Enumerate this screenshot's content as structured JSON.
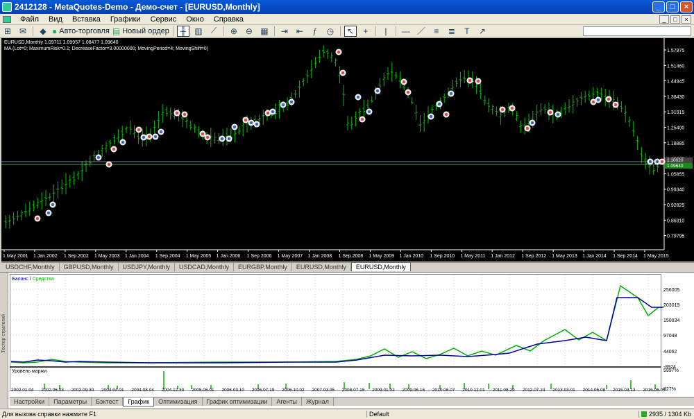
{
  "window": {
    "title": "2412128 - MetaQuotes-Demo - Демо-счет - [EURUSD,Monthly]",
    "controls": [
      "_",
      "□",
      "×"
    ]
  },
  "menu": {
    "items": [
      "Файл",
      "Вид",
      "Вставка",
      "Графики",
      "Сервис",
      "Окно",
      "Справка"
    ],
    "mdi_controls": [
      "_",
      "□",
      "×"
    ]
  },
  "toolbar": {
    "autotrade_label": "Авто-торговля",
    "neworder_label": "Новый ордер"
  },
  "chart": {
    "info_line1": "EURUSD,Monthly  1.09711 1.09957 1.08477 1.09640",
    "info_line2": "MA (Lot=0; MaximumRisk=0.1; DecreaseFactor=3.00000000; MovingPeriod=4; MovingShift=0)",
    "price_labels": [
      "1.57975",
      "1.51460",
      "1.44945",
      "1.38430",
      "1.31915",
      "1.25400",
      "1.18885",
      "1.12370",
      "1.05855",
      "0.99340",
      "0.92825",
      "0.86310",
      "0.79795"
    ],
    "current_price_1": "1.10020",
    "current_price_2": "1.09640",
    "time_labels": [
      "1 May 2001",
      "1 Jan 2002",
      "1 Sep 2002",
      "1 May 2003",
      "1 Jan 2004",
      "1 Sep 2004",
      "1 May 2005",
      "1 Jan 2006",
      "1 Sep 2006",
      "1 May 2007",
      "1 Jan 2008",
      "1 Sep 2008",
      "1 May 2009",
      "1 Jan 2010",
      "1 Sep 2010",
      "1 May 2011",
      "1 Jan 2012",
      "1 Sep 2012",
      "1 May 2013",
      "1 Jan 2014",
      "1 Sep 2014",
      "1 May 2015"
    ],
    "colors": {
      "bull": "#00c000",
      "bear": "#00c000",
      "buy_marker": "#3060c0",
      "sell_marker": "#e04040"
    }
  },
  "chart_tabs": [
    "USDCHF,Monthly",
    "GBPUSD,Monthly",
    "USDJPY,Monthly",
    "USDCAD,Monthly",
    "EURGBP,Monthly",
    "EURUSD,Monthly",
    "EURUSD,Monthly"
  ],
  "tester": {
    "side_label": "Тестер стратегий",
    "legend_balance": "Баланс",
    "legend_sep": " / ",
    "legend_equity": "Средства",
    "balance_color": "#0000a0",
    "equity_color": "#00b000",
    "y_labels": [
      "256005",
      "203019",
      "150034",
      "97048",
      "44062",
      "-8924"
    ],
    "margin_title": "Уровень маржи",
    "margin_labels": [
      "5997%",
      "827%"
    ],
    "date_labels": [
      "2002.01.04",
      "2002.06.03",
      "2003.09.30",
      "2004.04.01",
      "2004.08.04",
      "2004.12.30",
      "2005.06.01",
      "2006.03.10",
      "2006.07.19",
      "2006.10.02",
      "2007.03.05",
      "2008.07.15",
      "2009.01.02",
      "2009.06.16",
      "2010.06.07",
      "2010.12.01",
      "2011.08.29",
      "2012.07.24",
      "2013.03.01",
      "2014.05.08",
      "2015.03.13",
      "2015.06.05"
    ]
  },
  "bottom_tabs": [
    "Настройки",
    "Параметры",
    "Бэктест",
    "График",
    "Оптимизация",
    "График оптимизации",
    "Агенты",
    "Журнал"
  ],
  "status": {
    "help": "Для вызова справки нажмите F1",
    "profile": "Default",
    "traffic": "2935 / 1304 Kb"
  }
}
